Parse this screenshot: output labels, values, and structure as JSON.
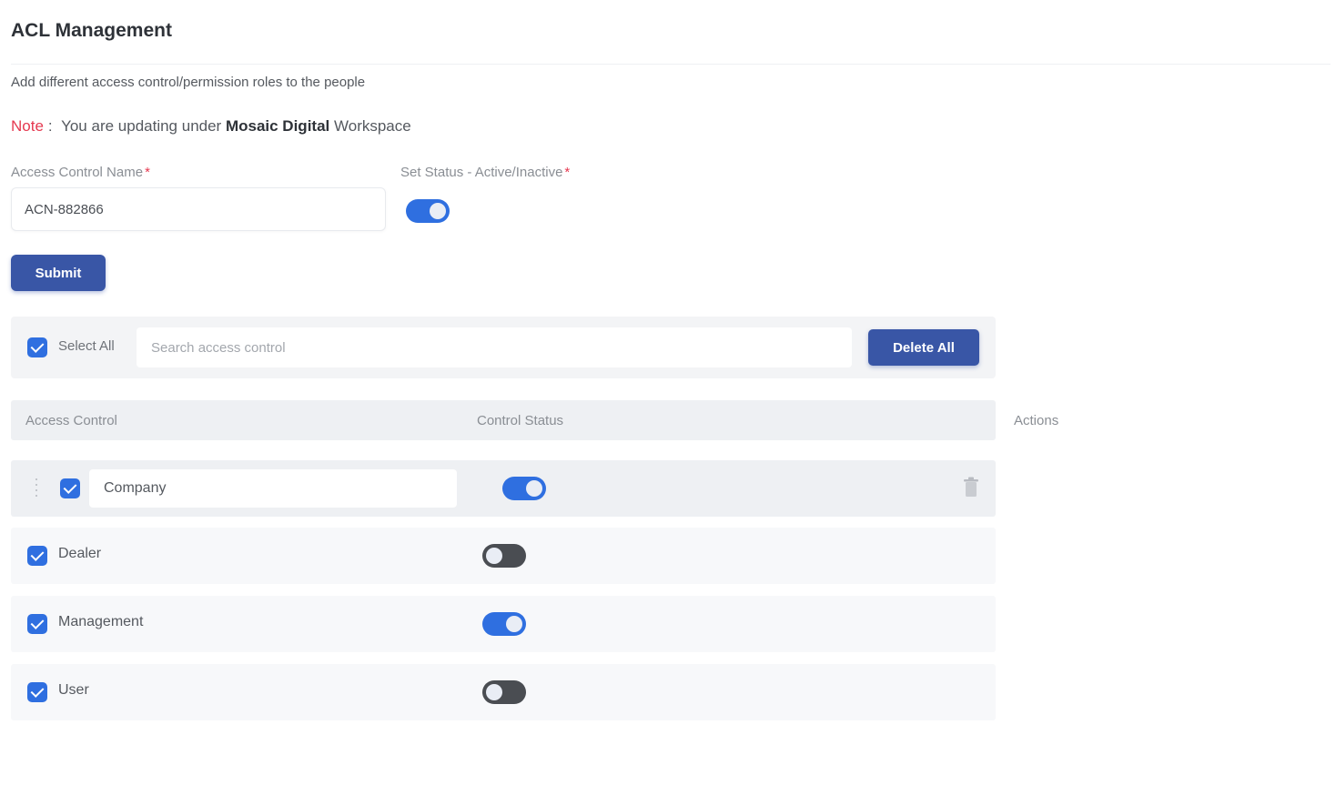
{
  "header": {
    "title": "ACL Management",
    "subtitle": "Add different access control/permission roles to the people"
  },
  "note": {
    "label": "Note",
    "separator": ":",
    "text_before": "You are updating under",
    "workspace": "Mosaic Digital",
    "text_after": "Workspace"
  },
  "form": {
    "name_label": "Access Control Name",
    "name_value": "ACN-882866",
    "status_label": "Set Status - Active/Inactive",
    "status_active": true,
    "submit_label": "Submit"
  },
  "toolbar": {
    "select_all_label": "Select All",
    "search_placeholder": "Search access control",
    "delete_all_label": "Delete All"
  },
  "table": {
    "columns": {
      "access_control": "Access Control",
      "control_status": "Control Status",
      "actions": "Actions"
    },
    "rows": [
      {
        "label": "Company",
        "active": true,
        "checked": true,
        "editing": true
      },
      {
        "label": "Dealer",
        "active": false,
        "checked": true,
        "editing": false
      },
      {
        "label": "Management",
        "active": true,
        "checked": true,
        "editing": false
      },
      {
        "label": "User",
        "active": false,
        "checked": true,
        "editing": false
      }
    ]
  },
  "colors": {
    "primary": "#3956a6",
    "toggle_on": "#2f6fe0",
    "toggle_off": "#4a4d52",
    "note_accent": "#e53950"
  },
  "icons": {
    "drag": "drag-handle-icon",
    "delete": "trash-icon"
  }
}
